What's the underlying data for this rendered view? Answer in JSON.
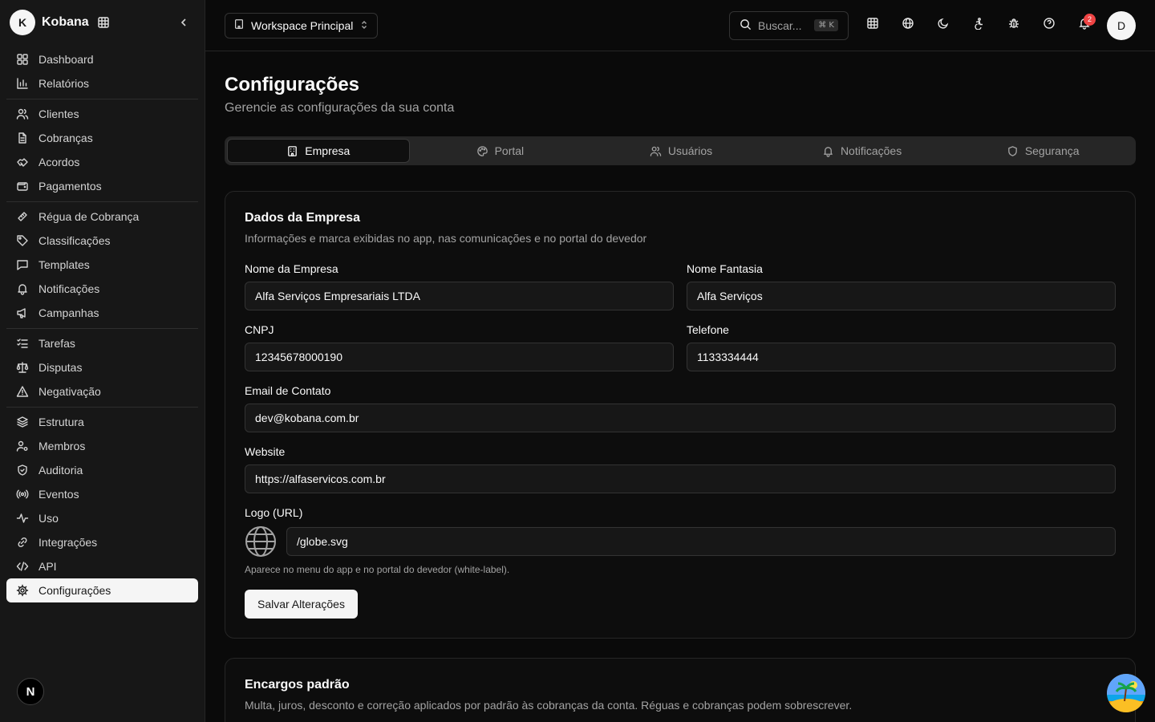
{
  "brand": {
    "initial": "K",
    "name": "Kobana"
  },
  "sidebar": {
    "groups": [
      [
        {
          "label": "Dashboard",
          "icon": "layout-grid-icon"
        },
        {
          "label": "Relatórios",
          "icon": "bar-chart-icon"
        }
      ],
      [
        {
          "label": "Clientes",
          "icon": "users-icon"
        },
        {
          "label": "Cobranças",
          "icon": "file-text-icon"
        },
        {
          "label": "Acordos",
          "icon": "handshake-icon"
        },
        {
          "label": "Pagamentos",
          "icon": "wallet-icon"
        }
      ],
      [
        {
          "label": "Régua de Cobrança",
          "icon": "ruler-icon"
        },
        {
          "label": "Classificações",
          "icon": "tag-icon"
        },
        {
          "label": "Templates",
          "icon": "message-square-icon"
        },
        {
          "label": "Notificações",
          "icon": "bell-icon"
        },
        {
          "label": "Campanhas",
          "icon": "megaphone-icon"
        }
      ],
      [
        {
          "label": "Tarefas",
          "icon": "list-checks-icon"
        },
        {
          "label": "Disputas",
          "icon": "scale-icon"
        },
        {
          "label": "Negativação",
          "icon": "alert-triangle-icon"
        }
      ],
      [
        {
          "label": "Estrutura",
          "icon": "layers-icon"
        },
        {
          "label": "Membros",
          "icon": "user-cog-icon"
        },
        {
          "label": "Auditoria",
          "icon": "shield-check-icon"
        },
        {
          "label": "Eventos",
          "icon": "radio-icon"
        },
        {
          "label": "Uso",
          "icon": "activity-icon"
        },
        {
          "label": "Integrações",
          "icon": "link-icon"
        },
        {
          "label": "API",
          "icon": "code-icon"
        },
        {
          "label": "Configurações",
          "icon": "settings-icon",
          "active": true
        }
      ]
    ],
    "footer_badge": "N"
  },
  "topbar": {
    "workspace": "Workspace Principal",
    "search_placeholder": "Buscar...",
    "search_kbd": "⌘ K",
    "notification_count": "2",
    "user_initial": "D"
  },
  "page": {
    "title": "Configurações",
    "subtitle": "Gerencie as configurações da sua conta"
  },
  "tabs": [
    {
      "label": "Empresa",
      "icon": "building-icon",
      "active": true
    },
    {
      "label": "Portal",
      "icon": "palette-icon"
    },
    {
      "label": "Usuários",
      "icon": "users-icon"
    },
    {
      "label": "Notificações",
      "icon": "bell-icon"
    },
    {
      "label": "Segurança",
      "icon": "shield-icon"
    }
  ],
  "company": {
    "title": "Dados da Empresa",
    "description": "Informações e marca exibidas no app, nas comunicações e no portal do devedor",
    "company_name_label": "Nome da Empresa",
    "company_name_value": "Alfa Serviços Empresariais LTDA",
    "trade_name_label": "Nome Fantasia",
    "trade_name_value": "Alfa Serviços",
    "cnpj_label": "CNPJ",
    "cnpj_value": "12345678000190",
    "phone_label": "Telefone",
    "phone_value": "1133334444",
    "email_label": "Email de Contato",
    "email_value": "dev@kobana.com.br",
    "website_label": "Website",
    "website_value": "https://alfaservicos.com.br",
    "logo_label": "Logo (URL)",
    "logo_value": "/globe.svg",
    "logo_helper": "Aparece no menu do app e no portal do devedor (white-label).",
    "save_label": "Salvar Alterações"
  },
  "charges": {
    "title": "Encargos padrão",
    "description": "Multa, juros, desconto e correção aplicados por padrão às cobranças da conta. Réguas e cobranças podem sobrescrever."
  },
  "colors": {
    "accent": "#f5f5f5",
    "background": "#0a0a0a",
    "sidebar": "#171717",
    "badge": "#ef4444"
  }
}
